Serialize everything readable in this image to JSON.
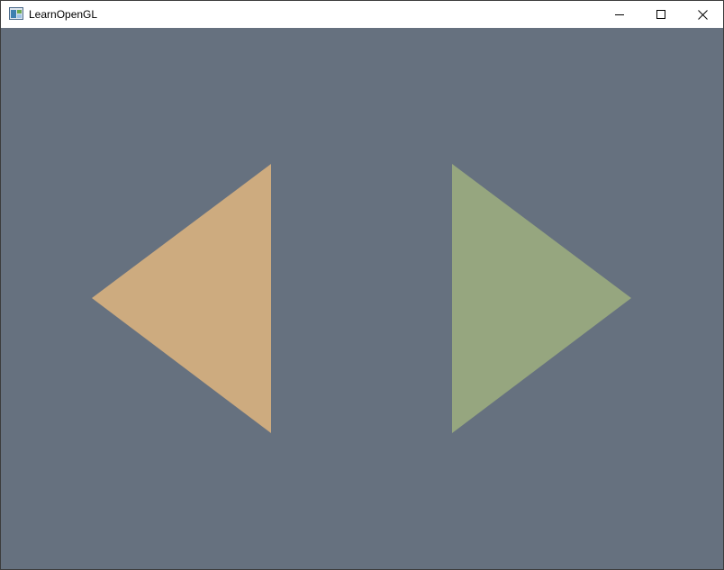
{
  "window": {
    "title": "LearnOpenGL",
    "app_icon": "opengl-window-icon",
    "controls": [
      {
        "name": "minimize",
        "icon": "minimize-icon"
      },
      {
        "name": "maximize",
        "icon": "maximize-icon"
      },
      {
        "name": "close",
        "icon": "close-icon"
      }
    ]
  },
  "scene": {
    "clear_color": "#66717f",
    "shapes": [
      {
        "name": "left-triangle",
        "direction": "left",
        "color": "#cdab7f"
      },
      {
        "name": "right-triangle",
        "direction": "right",
        "color": "#96a67f"
      }
    ]
  }
}
